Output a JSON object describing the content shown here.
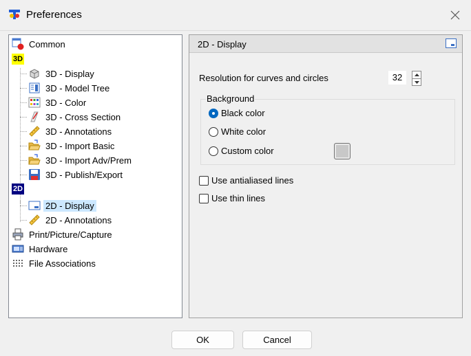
{
  "window": {
    "title": "Preferences"
  },
  "tree": {
    "common": "Common",
    "group_3d": "3D",
    "items_3d": [
      {
        "label": "3D - Display",
        "icon": "cube-icon"
      },
      {
        "label": "3D - Model Tree",
        "icon": "model-tree-icon"
      },
      {
        "label": "3D - Color",
        "icon": "color-palette-icon"
      },
      {
        "label": "3D - Cross Section",
        "icon": "cross-section-icon"
      },
      {
        "label": "3D - Annotations",
        "icon": "ruler-icon"
      },
      {
        "label": "3D - Import Basic",
        "icon": "folder-open-icon"
      },
      {
        "label": "3D - Import Adv/Prem",
        "icon": "folder-open-icon"
      },
      {
        "label": "3D - Publish/Export",
        "icon": "floppy-disk-icon"
      }
    ],
    "group_2d": "2D",
    "items_2d": [
      {
        "label": "2D - Display",
        "icon": "window-icon",
        "selected": true
      },
      {
        "label": "2D - Annotations",
        "icon": "ruler-icon"
      }
    ],
    "print": "Print/Picture/Capture",
    "hardware": "Hardware",
    "file_assoc": "File Associations"
  },
  "panel": {
    "title": "2D - Display",
    "resolution_label": "Resolution for curves and circles",
    "resolution_value": "32",
    "background_label": "Background",
    "radio_black": "Black color",
    "radio_white": "White color",
    "radio_custom": "Custom color",
    "selected_background": "Black color",
    "custom_color_hex": "#c8c8c8",
    "antialiased_label": "Use antialiased lines",
    "antialiased_checked": false,
    "thin_lines_label": "Use thin lines",
    "thin_lines_checked": false
  },
  "buttons": {
    "ok": "OK",
    "cancel": "Cancel"
  },
  "colors": {
    "selection": "#cce8ff",
    "accent": "#0067c0"
  }
}
